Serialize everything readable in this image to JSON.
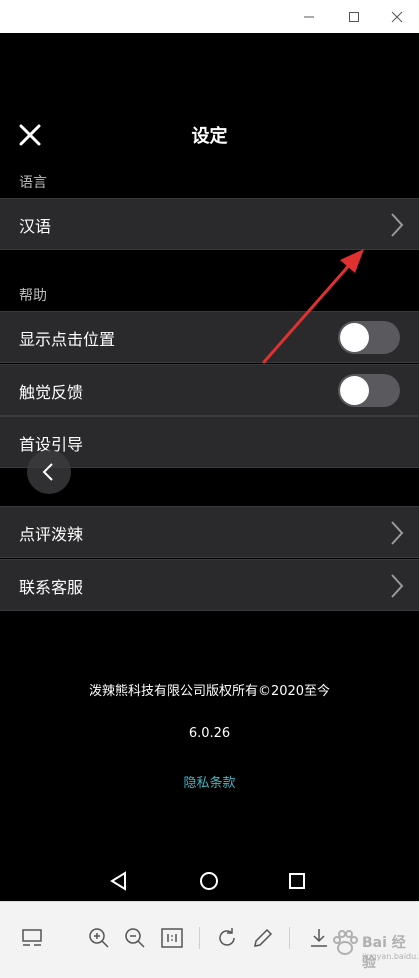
{
  "header": {
    "title": "设定"
  },
  "sections": {
    "language_label": "语言",
    "help_label": "帮助"
  },
  "rows": {
    "language": "汉语",
    "show_touch": "显示点击位置",
    "haptic": "触觉反馈",
    "first_guide": "首设引导",
    "rate": "点评泼辣",
    "contact": "联系客服"
  },
  "toggles": {
    "show_touch_on": false,
    "haptic_on": false
  },
  "footer": {
    "copyright": "泼辣熊科技有限公司版权所有©2020至今",
    "version": "6.0.26",
    "privacy": "隐私条款"
  },
  "watermark": {
    "text": "Bai 经验",
    "sub": "jingyan.baidu.com"
  },
  "colors": {
    "screen_bg": "#000000",
    "row_bg": "#2a2a2c",
    "link": "#46b4c2",
    "arrow": "#e03131"
  },
  "icons": [
    "minimize-icon",
    "maximize-icon",
    "window-close-icon",
    "close-icon",
    "chevron-right-icon",
    "back-icon",
    "nav-back-icon",
    "nav-home-icon",
    "nav-recents-icon",
    "layout-icon",
    "zoom-in-icon",
    "zoom-out-icon",
    "actual-size-icon",
    "rotate-icon",
    "edit-icon",
    "download-icon",
    "paw-icon"
  ]
}
